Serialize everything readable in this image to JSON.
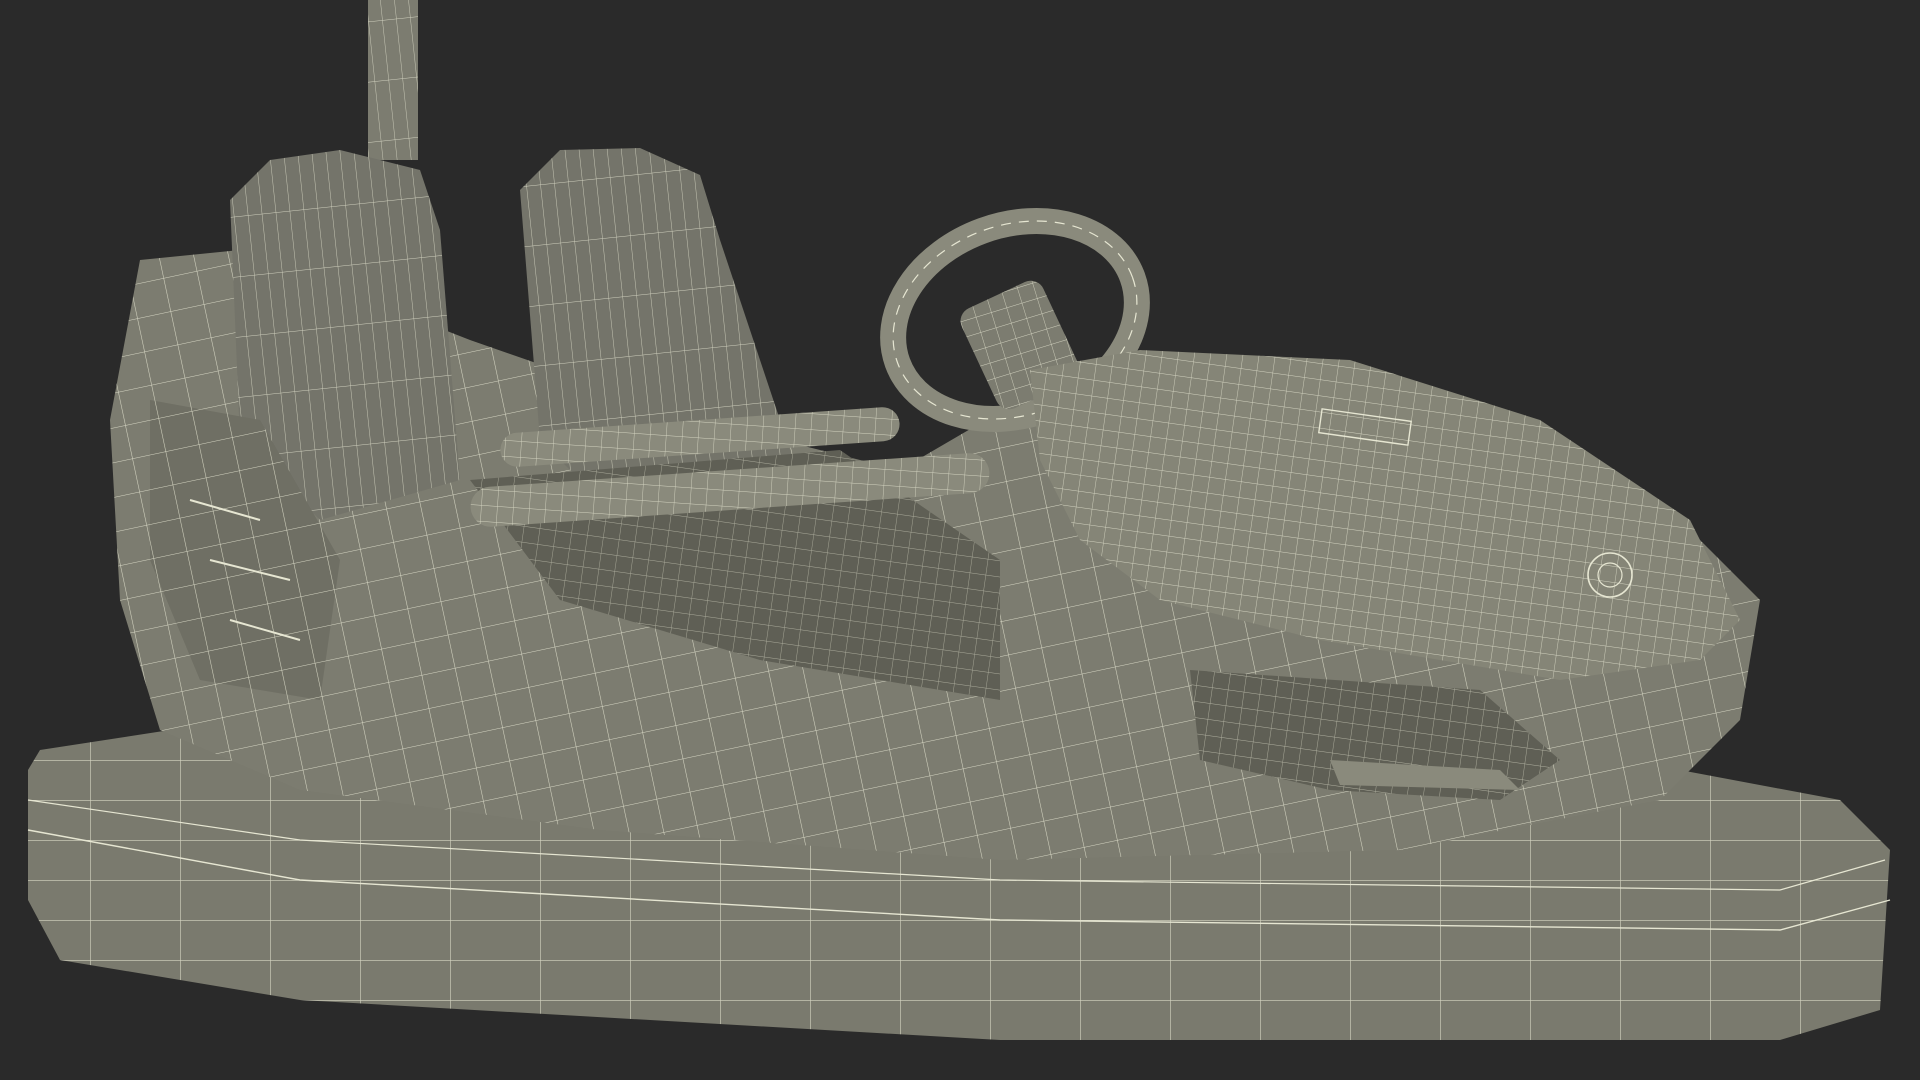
{
  "scene": {
    "subject": "bumper-car-wireframe-render",
    "colors": {
      "background": "#2a2a2a",
      "surface": "#7c7c70",
      "surface_dark": "#5f5f55",
      "surface_light": "#8e8e80",
      "wire": "#e6e6d2"
    }
  }
}
